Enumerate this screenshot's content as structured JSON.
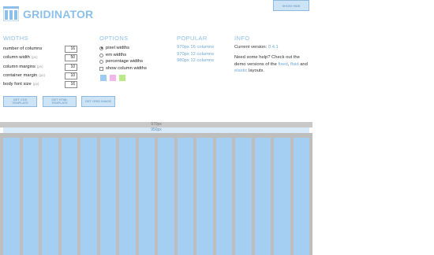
{
  "app": {
    "title": "GRIDINATOR",
    "top_button": "SHOW HIDE"
  },
  "widths": {
    "title": "WIDTHS",
    "rows": [
      {
        "label": "number of columns",
        "unit": "",
        "value": "16"
      },
      {
        "label": "column width",
        "unit": "(px)",
        "value": "50"
      },
      {
        "label": "column margins",
        "unit": "(px)",
        "value": "10"
      },
      {
        "label": "container margin",
        "unit": "(px)",
        "value": "10"
      },
      {
        "label": "body font size",
        "unit": "(px)",
        "value": "16"
      }
    ]
  },
  "options": {
    "title": "OPTIONS",
    "radios": [
      {
        "label": "pixel widths",
        "checked": true
      },
      {
        "label": "em widths",
        "checked": false
      },
      {
        "label": "percentage widths",
        "checked": false
      }
    ],
    "checkbox": {
      "label": "show column widths",
      "checked": false
    },
    "swatches": [
      "#9ecbf2",
      "#f2b6ea",
      "#b9ea84"
    ]
  },
  "popular": {
    "title": "POPULAR",
    "links": [
      "970px 16 columns",
      "970px 12 columns",
      "980px 12 columns"
    ]
  },
  "info": {
    "title": "INFO",
    "version_label": "Current version:",
    "version": "0.4.1",
    "line2": "Need some help? Check out the",
    "line3_pre": "demo versions of the",
    "link_fixed": "fixed",
    "link_fluid": "fluid",
    "line3_and": "and",
    "link_elastic": "elastic",
    "line4_post": "layouts."
  },
  "buttons": {
    "css": "GET CSS TEMPLATE",
    "html": "GET HTML TEMPLATE",
    "image": "GET GRID IMAGE"
  },
  "preview": {
    "container_label": "970px",
    "inner_label": "950px",
    "column_count": 16,
    "colors": {
      "outer": "#c8c8c8",
      "column": "#a4cff3",
      "accent": "#8cc0ea"
    }
  }
}
